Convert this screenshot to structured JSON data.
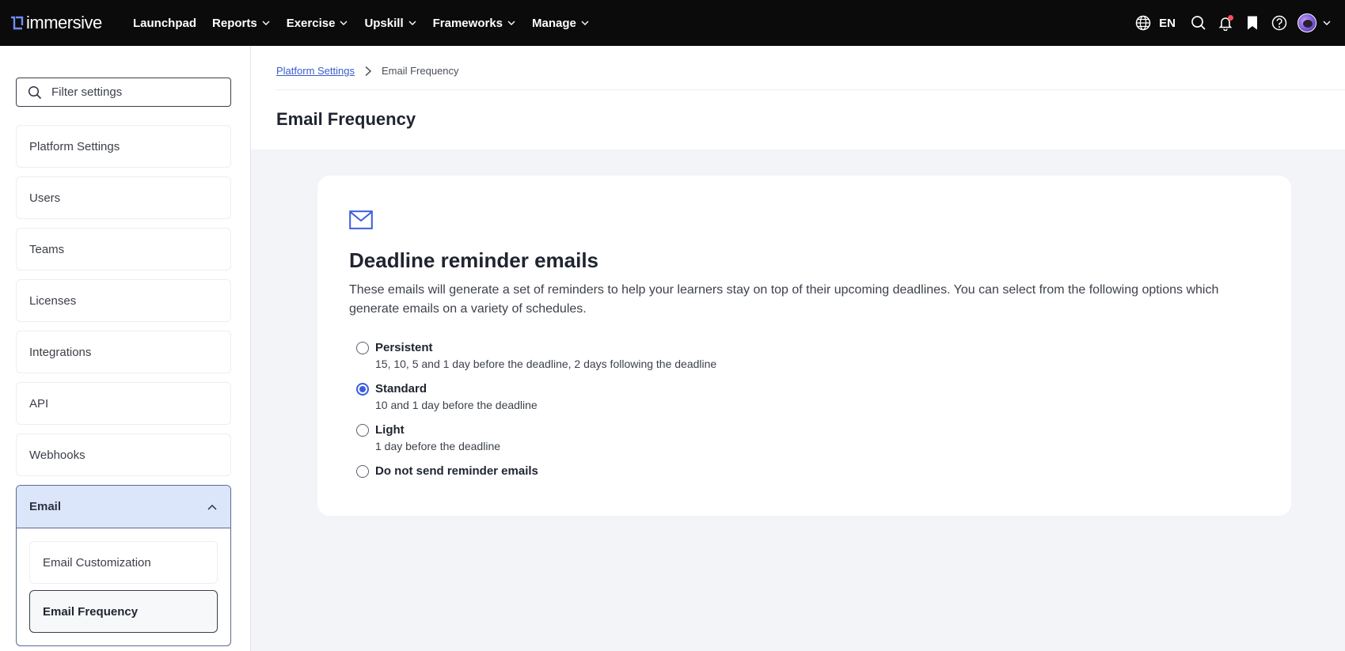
{
  "brand": {
    "name": "immersive",
    "accent": "#3a5ce0"
  },
  "topnav": {
    "items": [
      {
        "label": "Launchpad",
        "has_menu": false
      },
      {
        "label": "Reports",
        "has_menu": true
      },
      {
        "label": "Exercise",
        "has_menu": true
      },
      {
        "label": "Upskill",
        "has_menu": true
      },
      {
        "label": "Frameworks",
        "has_menu": true
      },
      {
        "label": "Manage",
        "has_menu": true
      }
    ],
    "language": "EN",
    "icons": [
      "globe-icon",
      "search-icon",
      "bell-icon",
      "bookmark-icon",
      "help-icon",
      "avatar"
    ]
  },
  "sidebar": {
    "filter_placeholder": "Filter settings",
    "items": [
      {
        "label": "Platform Settings"
      },
      {
        "label": "Users"
      },
      {
        "label": "Teams"
      },
      {
        "label": "Licenses"
      },
      {
        "label": "Integrations"
      },
      {
        "label": "API"
      },
      {
        "label": "Webhooks"
      }
    ],
    "email_group": {
      "label": "Email",
      "expanded": true,
      "children": [
        {
          "label": "Email Customization",
          "active": false
        },
        {
          "label": "Email Frequency",
          "active": true
        }
      ]
    }
  },
  "breadcrumb": {
    "parent": "Platform Settings",
    "current": "Email Frequency"
  },
  "page": {
    "title": "Email Frequency"
  },
  "card": {
    "icon": "mail-icon",
    "title": "Deadline reminder emails",
    "description": "These emails will generate a set of reminders to help your learners stay on top of their upcoming deadlines. You can select from the following options which generate emails on a variety of schedules.",
    "options": [
      {
        "label": "Persistent",
        "sub": "15, 10, 5 and 1 day before the deadline, 2 days following the deadline",
        "checked": false
      },
      {
        "label": "Standard",
        "sub": "10 and 1 day before the deadline",
        "checked": true
      },
      {
        "label": "Light",
        "sub": "1 day before the deadline",
        "checked": false
      },
      {
        "label": "Do not send reminder emails",
        "sub": "",
        "checked": false
      }
    ]
  }
}
